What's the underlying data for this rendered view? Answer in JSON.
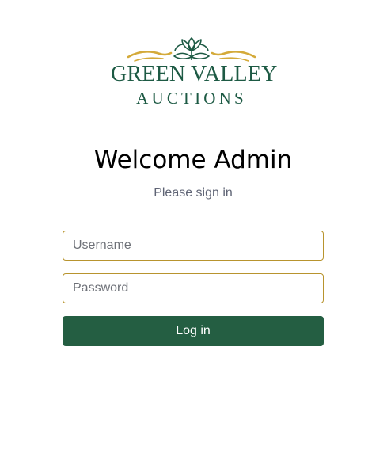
{
  "brand": {
    "line1": "GREEN VALLEY",
    "line2": "AUCTIONS",
    "colors": {
      "green": "#1d5a44",
      "gold": "#d4aa3a"
    },
    "icon": "tulip-flourish-logo"
  },
  "header": {
    "title": "Welcome Admin",
    "subtitle": "Please sign in"
  },
  "form": {
    "username": {
      "value": "",
      "placeholder": "Username"
    },
    "password": {
      "value": "",
      "placeholder": "Password"
    },
    "submit_label": "Log in"
  },
  "colors": {
    "field_border": "#b8942e",
    "button_bg": "#245e42",
    "button_text": "#ffffff",
    "subtitle": "#5f6475"
  }
}
